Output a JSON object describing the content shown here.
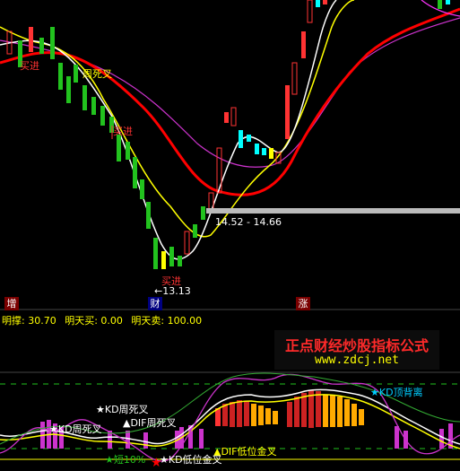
{
  "top_panel": {
    "buy_label_1": "买进",
    "buy_label_2": "买进",
    "buy_label_3": "买进",
    "kd_dead_cross": "周死叉",
    "price_range": "14.52 - 14.66",
    "low_price": "←13.13",
    "tag_zeng": "增",
    "tag_cai": "财",
    "tag_zhang": "涨"
  },
  "status_bar": {
    "mingcheng": "明撑: 30.70",
    "buy_tomorrow": "明天买: 0.00",
    "sell_tomorrow": "明天卖: 100.00"
  },
  "banner": {
    "title": "正点财经炒股指标公式",
    "url": "www.zdcj.net"
  },
  "bottom_panel": {
    "kd_top_divergence": "★KD顶背离",
    "kd_dead_cross_1": "★KD周死叉",
    "kd_dead_cross_2": "★KD周死叉",
    "dif_dead_cross": "▲DIF周死叉",
    "dif_low_golden": "▲DIF低位金叉",
    "short_term": "★短10%",
    "kd_low_golden": "★KD低位金叉"
  },
  "colors": {
    "up_candle": "#ff3333",
    "down_candle": "#22c21e",
    "cyan": "#00ffff",
    "ma_white": "#ffffff",
    "ma_yellow": "#ffff00",
    "ma_red": "#ff0000",
    "ma_purple": "#cc33cc"
  }
}
